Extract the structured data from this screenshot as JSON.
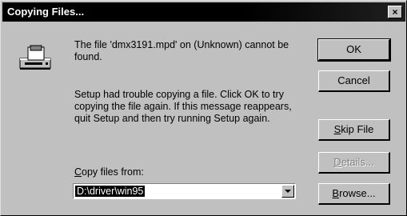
{
  "window": {
    "title": "Copying Files...",
    "close_label": "×"
  },
  "message": {
    "line1": "The file 'dmx3191.mpd' on (Unknown) cannot be found.",
    "line2": "Setup had trouble copying a file. Click OK to try copying the file again. If this message reappears, quit Setup and then try running Setup again."
  },
  "copy_from": {
    "label_first": "C",
    "label_rest": "opy files from:",
    "value": "D:\\driver\\win95"
  },
  "buttons": {
    "ok": "OK",
    "cancel": "Cancel",
    "skip_first": "S",
    "skip_rest": "kip File",
    "details_first": "D",
    "details_rest": "etails...",
    "browse_first": "B",
    "browse_rest": "rowse..."
  },
  "icons": {
    "dialog": "disk-drive-icon",
    "dropdown": "chevron-down-icon",
    "close": "close-icon"
  }
}
